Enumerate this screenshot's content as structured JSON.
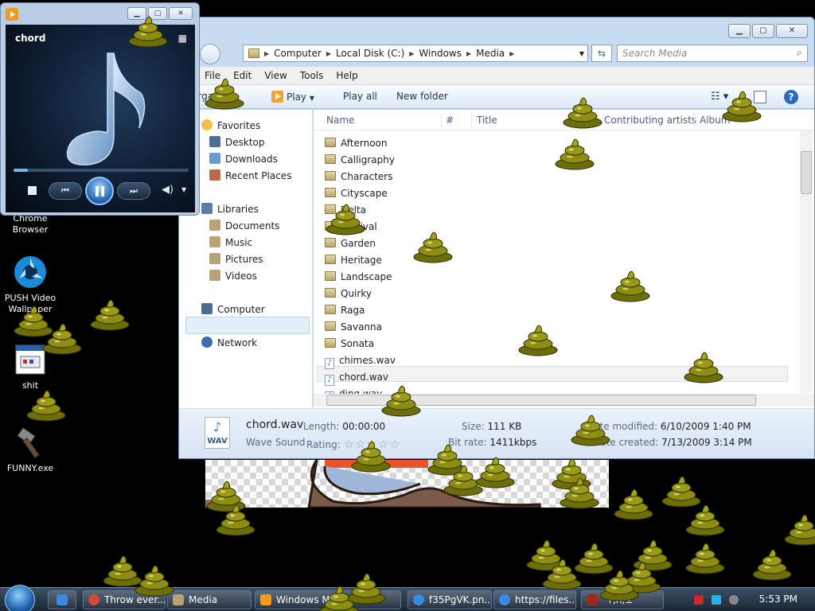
{
  "desktop": {
    "icons": [
      {
        "label": "Chrome Browser"
      },
      {
        "label": "PUSH Video Wallpaper"
      },
      {
        "label": "shit"
      },
      {
        "label": "FUNNY.exe"
      }
    ]
  },
  "player": {
    "track": "chord",
    "progress": 0.08,
    "controls": {
      "stop": "stop",
      "prev": "previous",
      "pause": "pause",
      "next": "next",
      "volume": "volume"
    }
  },
  "explorer": {
    "address": [
      "Computer",
      "Local Disk (C:)",
      "Windows",
      "Media"
    ],
    "search_placeholder": "Search Media",
    "menu": [
      "File",
      "Edit",
      "View",
      "Tools",
      "Help"
    ],
    "toolbar": {
      "organize": "Organize",
      "play": "Play",
      "play_all": "Play all",
      "new_folder": "New folder"
    },
    "nav": {
      "favorites": "Favorites",
      "favorites_items": [
        "Desktop",
        "Downloads",
        "Recent Places"
      ],
      "libraries": "Libraries",
      "libraries_items": [
        "Documents",
        "Music",
        "Pictures",
        "Videos"
      ],
      "computer": "Computer",
      "network": "Network"
    },
    "columns": {
      "name": "Name",
      "number": "#",
      "title": "Title",
      "artists": "Contributing artists",
      "album": "Album"
    },
    "files": [
      {
        "name": "Afternoon",
        "type": "folder"
      },
      {
        "name": "Calligraphy",
        "type": "folder"
      },
      {
        "name": "Characters",
        "type": "folder"
      },
      {
        "name": "Cityscape",
        "type": "folder"
      },
      {
        "name": "Delta",
        "type": "folder"
      },
      {
        "name": "Festival",
        "type": "folder"
      },
      {
        "name": "Garden",
        "type": "folder"
      },
      {
        "name": "Heritage",
        "type": "folder"
      },
      {
        "name": "Landscape",
        "type": "folder"
      },
      {
        "name": "Quirky",
        "type": "folder"
      },
      {
        "name": "Raga",
        "type": "folder"
      },
      {
        "name": "Savanna",
        "type": "folder"
      },
      {
        "name": "Sonata",
        "type": "folder"
      },
      {
        "name": "chimes.wav",
        "type": "wav"
      },
      {
        "name": "chord.wav",
        "type": "wav",
        "selected": true
      },
      {
        "name": "ding.wav",
        "type": "wav"
      }
    ],
    "details": {
      "filename": "chord.wav",
      "filetype": "Wave Sound",
      "length_label": "Length:",
      "length": "00:00:00",
      "rating_label": "Rating:",
      "rating_stars": "☆☆☆☆☆",
      "size_label": "Size:",
      "size": "111 KB",
      "bitrate_label": "Bit rate:",
      "bitrate": "1411kbps",
      "modified_label": "Date modified:",
      "modified": "6/10/2009 1:40 PM",
      "created_label": "Date created:",
      "created": "7/13/2009 3:14 PM",
      "icon_text": "WAV"
    }
  },
  "taskbar": {
    "buttons": [
      "Throw ever...",
      "Media",
      "Windows M...",
      "f35PgVK.pn...",
      "https://files...",
      "΄т,ń,±"
    ],
    "clock": "5:53 PM"
  },
  "colors": {
    "poop": "#8a8a10",
    "selection": "#e2eef9",
    "accent": "#2a6bc0"
  }
}
